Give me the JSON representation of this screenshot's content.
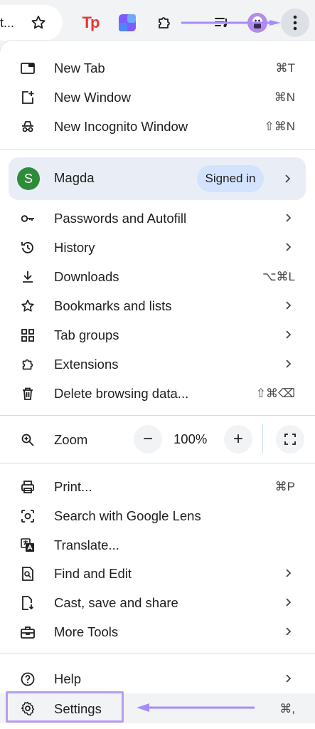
{
  "toolbar": {
    "omnibox_text": "t...",
    "icons": [
      "star-icon",
      "tp-extension-icon",
      "purple-extension-icon",
      "puzzle-extensions-icon",
      "reading-list-icon",
      "profile-avatar-icon",
      "more-vert-icon"
    ],
    "tp_logo_text": "Tp"
  },
  "menu": {
    "new_tab": {
      "label": "New Tab",
      "shortcut": "⌘T"
    },
    "new_window": {
      "label": "New Window",
      "shortcut": "⌘N"
    },
    "new_incognito": {
      "label": "New Incognito Window",
      "shortcut": "⇧⌘N"
    },
    "profile": {
      "initial": "S",
      "name": "Magda",
      "status": "Signed in"
    },
    "passwords": {
      "label": "Passwords and Autofill"
    },
    "history": {
      "label": "History"
    },
    "downloads": {
      "label": "Downloads",
      "shortcut": "⌥⌘L"
    },
    "bookmarks": {
      "label": "Bookmarks and lists"
    },
    "tab_groups": {
      "label": "Tab groups"
    },
    "extensions": {
      "label": "Extensions"
    },
    "delete_data": {
      "label": "Delete browsing data...",
      "shortcut": "⇧⌘⌫"
    },
    "zoom": {
      "label": "Zoom",
      "minus": "−",
      "value": "100%",
      "plus": "+"
    },
    "print": {
      "label": "Print...",
      "shortcut": "⌘P"
    },
    "lens": {
      "label": "Search with Google Lens"
    },
    "translate": {
      "label": "Translate..."
    },
    "find_edit": {
      "label": "Find and Edit"
    },
    "cast": {
      "label": "Cast, save and share"
    },
    "more_tools": {
      "label": "More Tools"
    },
    "help": {
      "label": "Help"
    },
    "settings": {
      "label": "Settings",
      "shortcut": "⌘,"
    }
  },
  "colors": {
    "annotation_purple": "#a78bfa",
    "profile_bg": "#e9eef6",
    "signed_in_pill": "#d3e3fd",
    "avatar_green": "#2e8b3a"
  }
}
